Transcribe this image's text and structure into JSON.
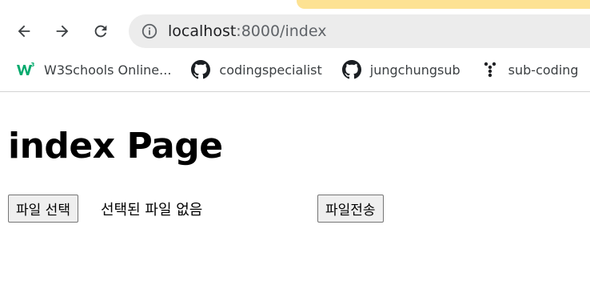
{
  "browser": {
    "url_host": "localhost",
    "url_path": ":8000/index",
    "tab_accent": "#fde293",
    "icons": {
      "back": "arrow-left-icon",
      "forward": "arrow-right-icon",
      "reload": "reload-icon",
      "info": "info-icon"
    }
  },
  "bookmarks": [
    {
      "label": "W3Schools Online...",
      "icon": "w3schools-icon",
      "color": "#04aa6d"
    },
    {
      "label": "codingspecialist",
      "icon": "github-icon"
    },
    {
      "label": "jungchungsub",
      "icon": "github-icon"
    },
    {
      "label": "sub-coding",
      "icon": "dots-icon"
    }
  ],
  "page": {
    "title": "index Page",
    "file_button_label": "파일 선택",
    "file_status": "선택된 파일 없음",
    "submit_label": "파일전송"
  }
}
